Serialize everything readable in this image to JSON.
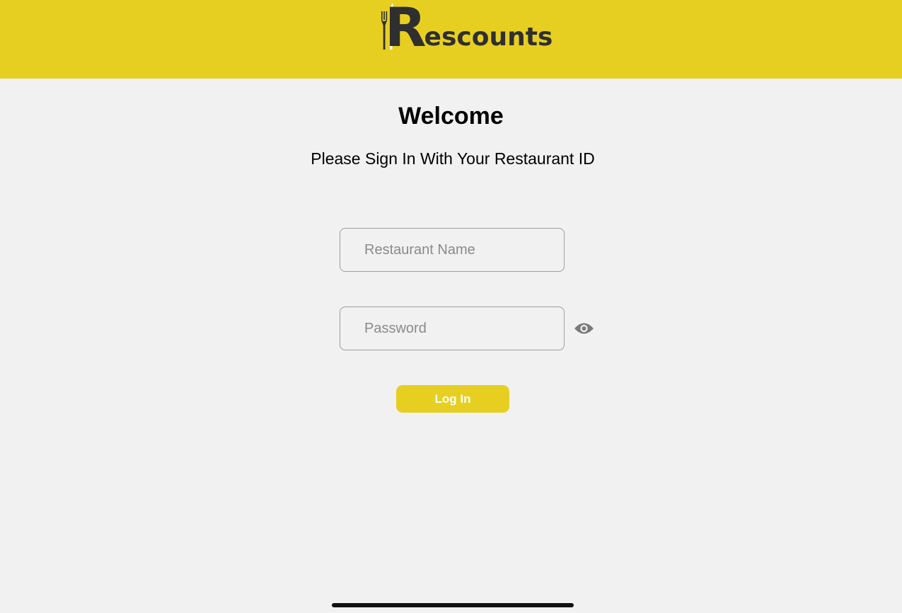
{
  "brand": {
    "logo_text_initial": "R",
    "logo_text_rest": "escounts",
    "header_color": "#e7cf22",
    "logo_color": "#2f2f2f"
  },
  "welcome": {
    "title": "Welcome",
    "subtitle": "Please Sign In With Your Restaurant ID"
  },
  "form": {
    "restaurant_name": {
      "value": "",
      "placeholder": "Restaurant Name"
    },
    "password": {
      "value": "",
      "placeholder": "Password"
    },
    "show_password_icon": "eye-icon",
    "login_label": "Log In",
    "login_color": "#e7cf22"
  }
}
